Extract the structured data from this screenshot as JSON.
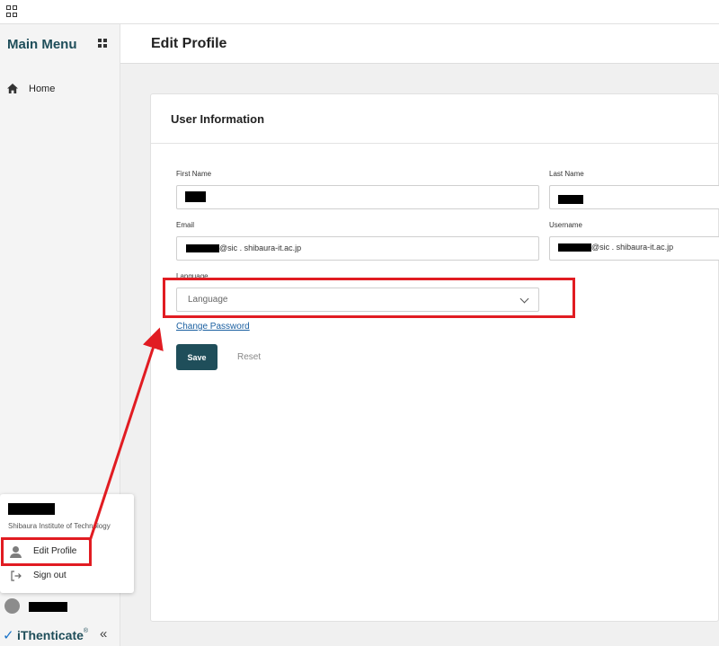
{
  "sidebar": {
    "title": "Main Menu",
    "home_label": "Home",
    "user_popup": {
      "organization": "Shibaura Institute of Technology",
      "edit_profile": "Edit Profile",
      "sign_out": "Sign out"
    },
    "brand": "iThenticate",
    "brand_reg": "®"
  },
  "header": {
    "title": "Edit Profile"
  },
  "card": {
    "title": "User Information",
    "first_name_label": "First Name",
    "last_name_label": "Last Name",
    "email_label": "Email",
    "email_value_suffix": "@sic . shibaura-it.ac.jp",
    "username_label": "Username",
    "username_value_suffix": "@sic . shibaura-it.ac.jp",
    "language_label": "Language",
    "language_placeholder": "Language",
    "change_password": "Change Password",
    "save": "Save",
    "reset": "Reset"
  },
  "colors": {
    "accent": "#1f4e5a",
    "link": "#1a5fa0",
    "highlight": "#e11c22"
  }
}
